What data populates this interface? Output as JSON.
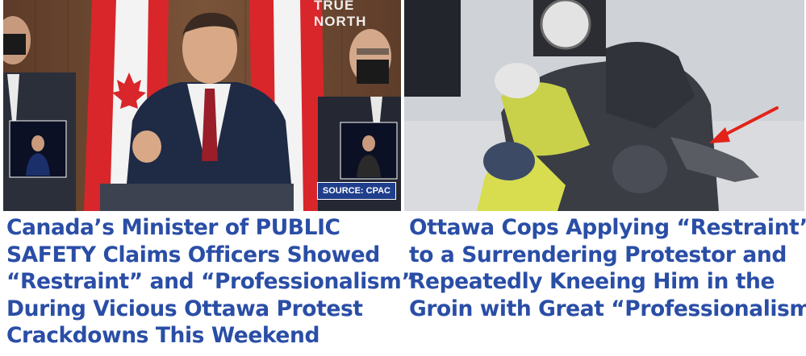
{
  "stories": [
    {
      "headline_lines": [
        "Canada’s Minister of PUBLIC",
        "SAFETY Claims Officers Showed",
        "“Restraint” and “Professionalism”",
        "During Vicious Ottawa Protest",
        "Crackdowns This Weekend"
      ],
      "photo": {
        "watermark": "TRUE NORTH",
        "source_badge": "SOURCE: CPAC"
      }
    },
    {
      "headline_lines": [
        "Ottawa Cops Applying “Restraint”",
        "to a Surrendering Protestor and",
        "Repeatedly Kneeing Him in the",
        "Groin with Great “Professionalism”"
      ],
      "photo": {
        "annotation_color": "#e2231a"
      }
    }
  ]
}
